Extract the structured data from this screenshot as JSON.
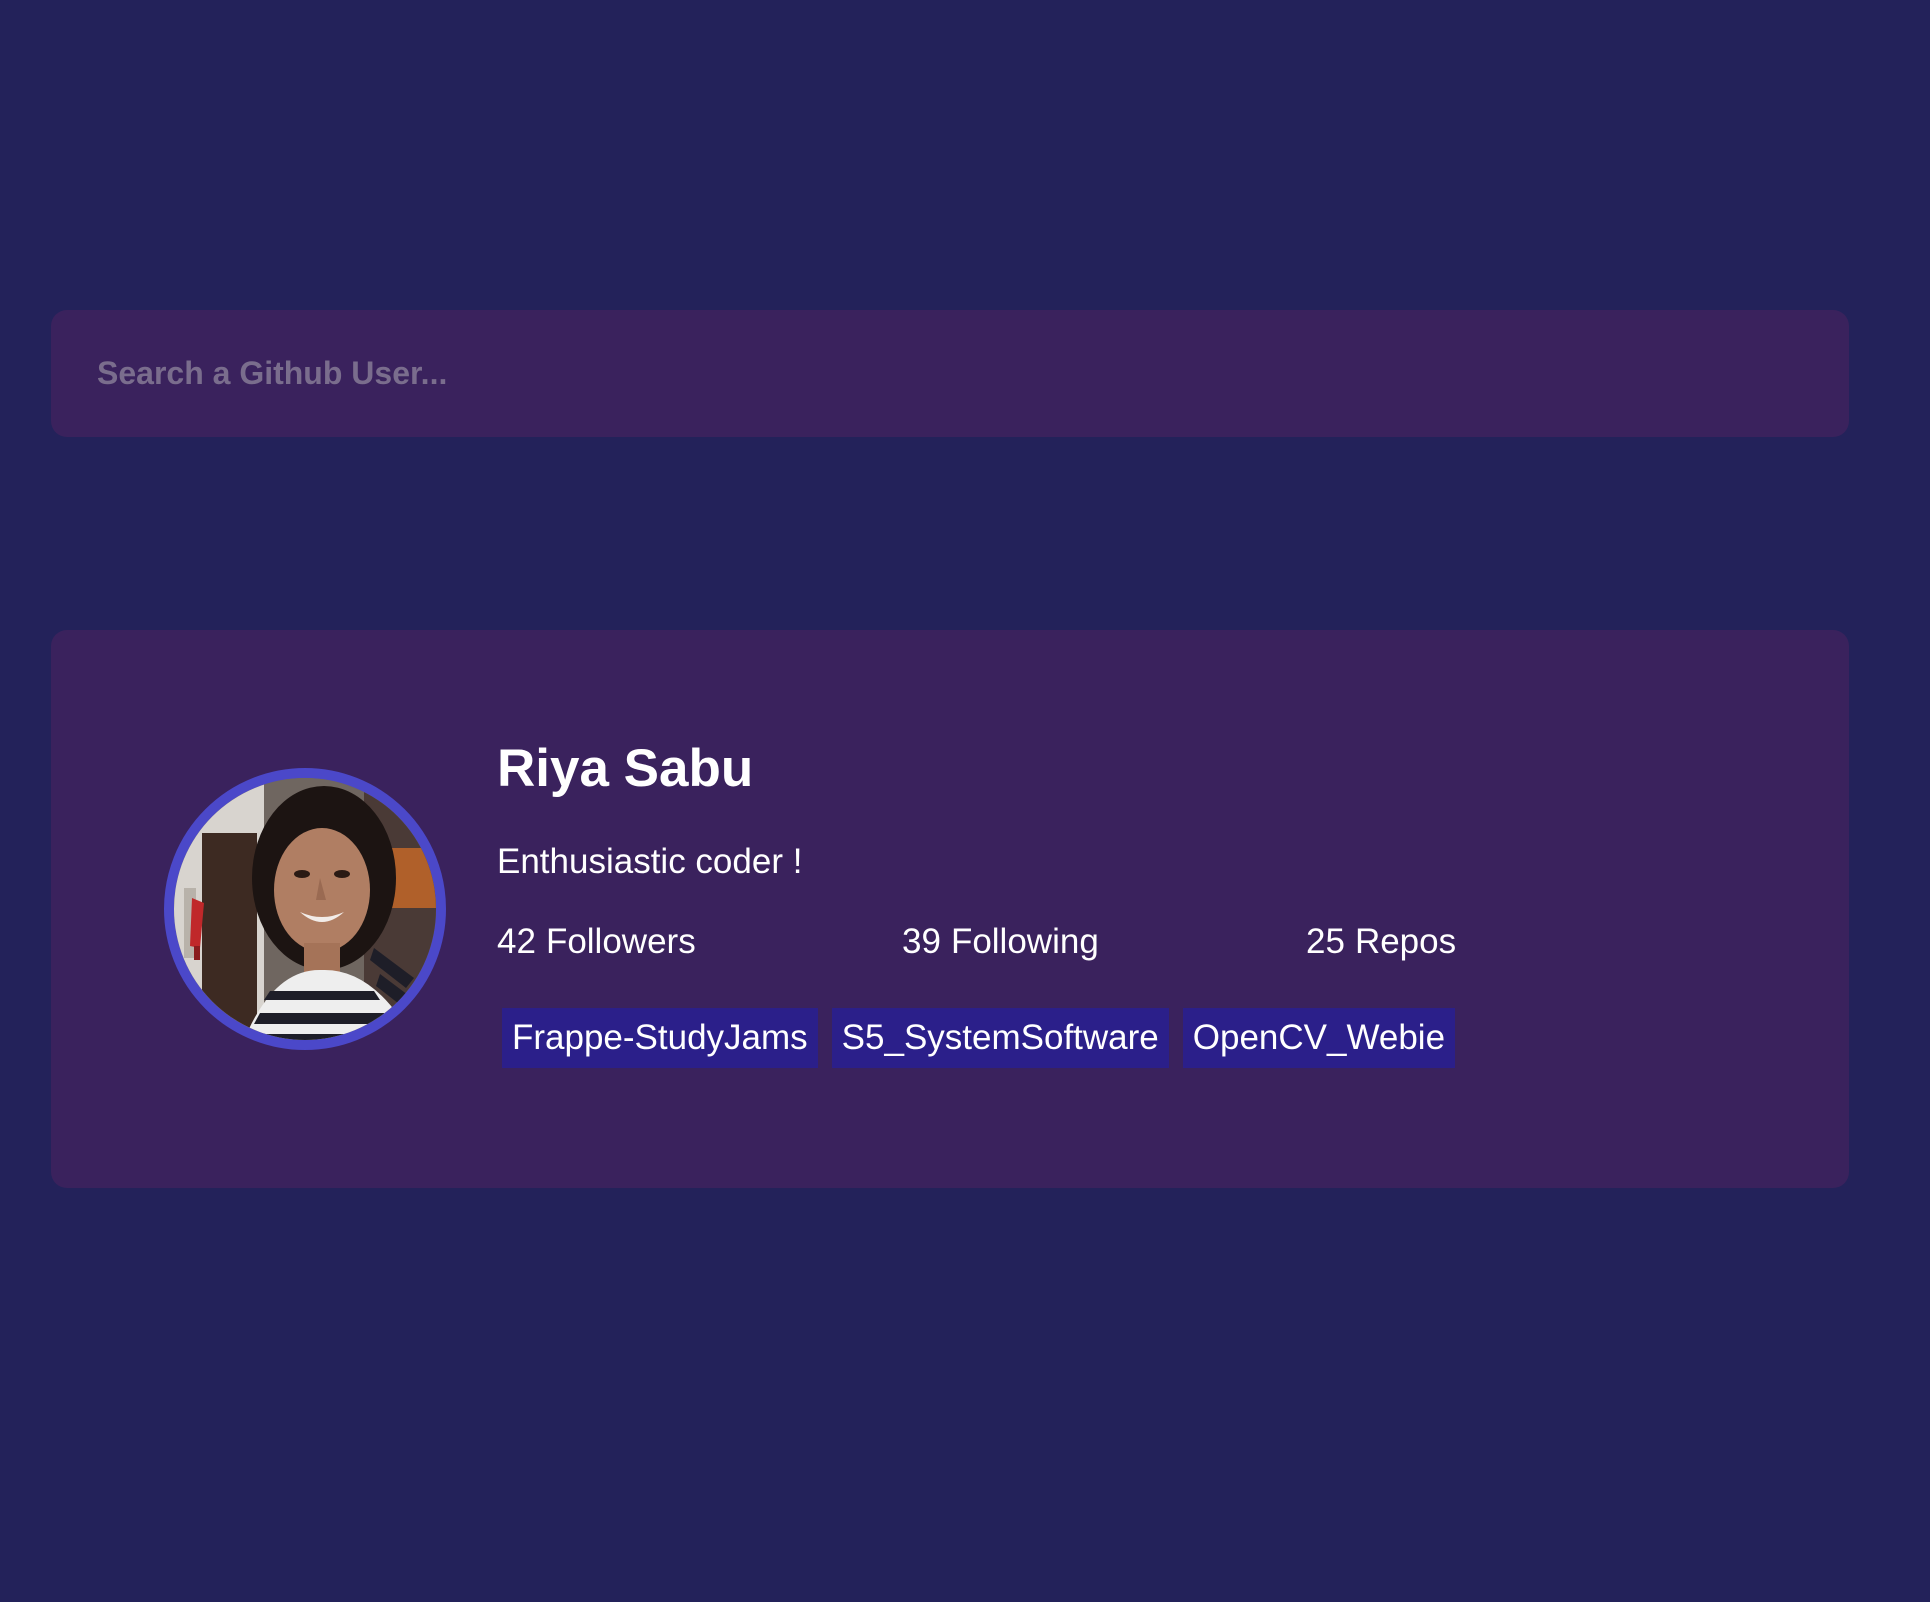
{
  "search": {
    "placeholder": "Search a Github User..."
  },
  "profile": {
    "name": "Riya Sabu",
    "bio": "Enthusiastic coder !",
    "stats": {
      "followers": {
        "count": "42",
        "label": "Followers"
      },
      "following": {
        "count": "39",
        "label": "Following"
      },
      "repos": {
        "count": "25",
        "label": "Repos"
      }
    },
    "repos": [
      "Frappe-StudyJams",
      "S5_SystemSoftware",
      "OpenCV_Webie"
    ]
  },
  "colors": {
    "page_background": "#23225a",
    "card_background": "#3a225d",
    "avatar_ring": "#4b48c9",
    "repo_tag": "#2b1f8a",
    "placeholder_text": "#7a6d8d",
    "text": "#ffffff"
  },
  "icons": {
    "avatar": "user-photo"
  }
}
